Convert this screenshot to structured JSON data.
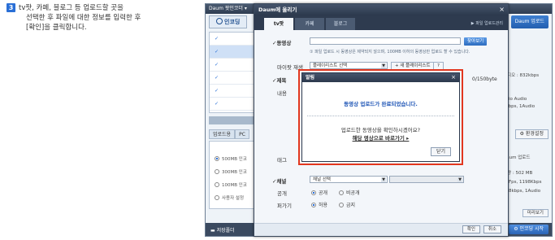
{
  "instruction": {
    "step": "3",
    "line1": "tv팟, 카페, 블로그 등 업로드할 곳을",
    "line2": "선택한 후 파일에 대한 정보를 입력한 후",
    "line3": "[확인]을 클릭합니다."
  },
  "app": {
    "title": "Daum 팟인코더 ▾",
    "tab_encode": "인코딩",
    "upload_button": "Daum 업로드",
    "file_rows": [
      "✓",
      "✓",
      "✓",
      "✓",
      "✓",
      "✓"
    ],
    "left_tabs": [
      "업로드용",
      "PC"
    ],
    "radio_options": [
      "500MB 인코",
      "300MB 인코",
      "100MB 인코",
      "사용자 설정"
    ],
    "right_info_top": [
      "오디오 : 832kbps",
      "udio Audio",
      "4kbps, 1Audio"
    ],
    "settings_button": "환경설정",
    "right_info_bottom": [
      "Daum 업로드",
      "용량 : 502 MB",
      "00Fps, 1198Kbps",
      "128kbps, 1Audio"
    ],
    "detail_button": "미리보기",
    "bottom_left": "저장폴더",
    "start_button": "인코딩 시작"
  },
  "dialog": {
    "title": "Daum에 올리기",
    "tabs": [
      "tv팟",
      "카페",
      "블로그"
    ],
    "tabs_note": "▶ 파일 업로드관리",
    "video_label": "✓동영상",
    "video_button": "찾아보기",
    "video_hint": "① 파일 업로드 시 동영상은 제약되지 않으며, 100MB 이하의 동영상만 업로드 할 수 있습니다.",
    "playlist_label": "마이팟 재생",
    "playlist_value": "플레이리스트 선택",
    "playlist_add_button": "+ 새 플레이리스트",
    "playlist_help": "?",
    "title_label": "✓제목",
    "title_counter": "0/150byte",
    "content_label": "내용",
    "tag_label": "태그",
    "channel_label": "✓채널",
    "channel_value": "채널 선택",
    "public_label": "공개",
    "public_options": [
      "공개",
      "비공개"
    ],
    "scrap_label": "퍼가기",
    "scrap_options": [
      "허용",
      "금지"
    ],
    "ok_button": "확인",
    "cancel_button": "취소"
  },
  "popup": {
    "title": "알림",
    "close": "×",
    "message": "동영상 업로드가 완료되었습니다.",
    "question": "업로드한 동영상을 확인하시겠어요?",
    "link": "해당 영상으로 바로가기 ▸",
    "ok_button": "닫기"
  }
}
